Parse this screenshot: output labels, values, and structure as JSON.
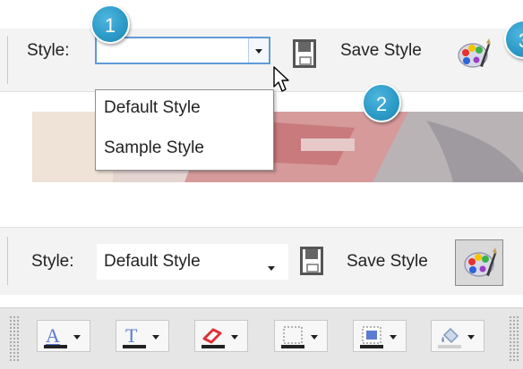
{
  "top_toolbar": {
    "style_label": "Style:",
    "style_value": "",
    "save_style_label": "Save Style",
    "dropdown_options": [
      "Default Style",
      "Sample Style"
    ]
  },
  "callouts": [
    "1",
    "2",
    "3"
  ],
  "bottom_toolbar": {
    "style_label": "Style:",
    "style_value": "Default Style",
    "save_style_label": "Save Style"
  },
  "format_toolbar": {
    "buttons": [
      {
        "icon": "font-color-icon",
        "glyph": "A",
        "color": "#5b7bd5"
      },
      {
        "icon": "text-highlight-icon",
        "glyph": "T",
        "color": "#5b7bd5"
      },
      {
        "icon": "eraser-icon",
        "color": "#e0303a"
      },
      {
        "icon": "border-icon",
        "color": "#9a9a9a"
      },
      {
        "icon": "fill-color-icon",
        "color": "#5b7bd5"
      },
      {
        "icon": "paint-bucket-icon",
        "color": "#7a9ac0"
      }
    ]
  },
  "colors": {
    "accent": "#2d9bc8",
    "combo_focus_border": "#5f9bd8",
    "toolbar_bg": "#f3f3f3"
  }
}
